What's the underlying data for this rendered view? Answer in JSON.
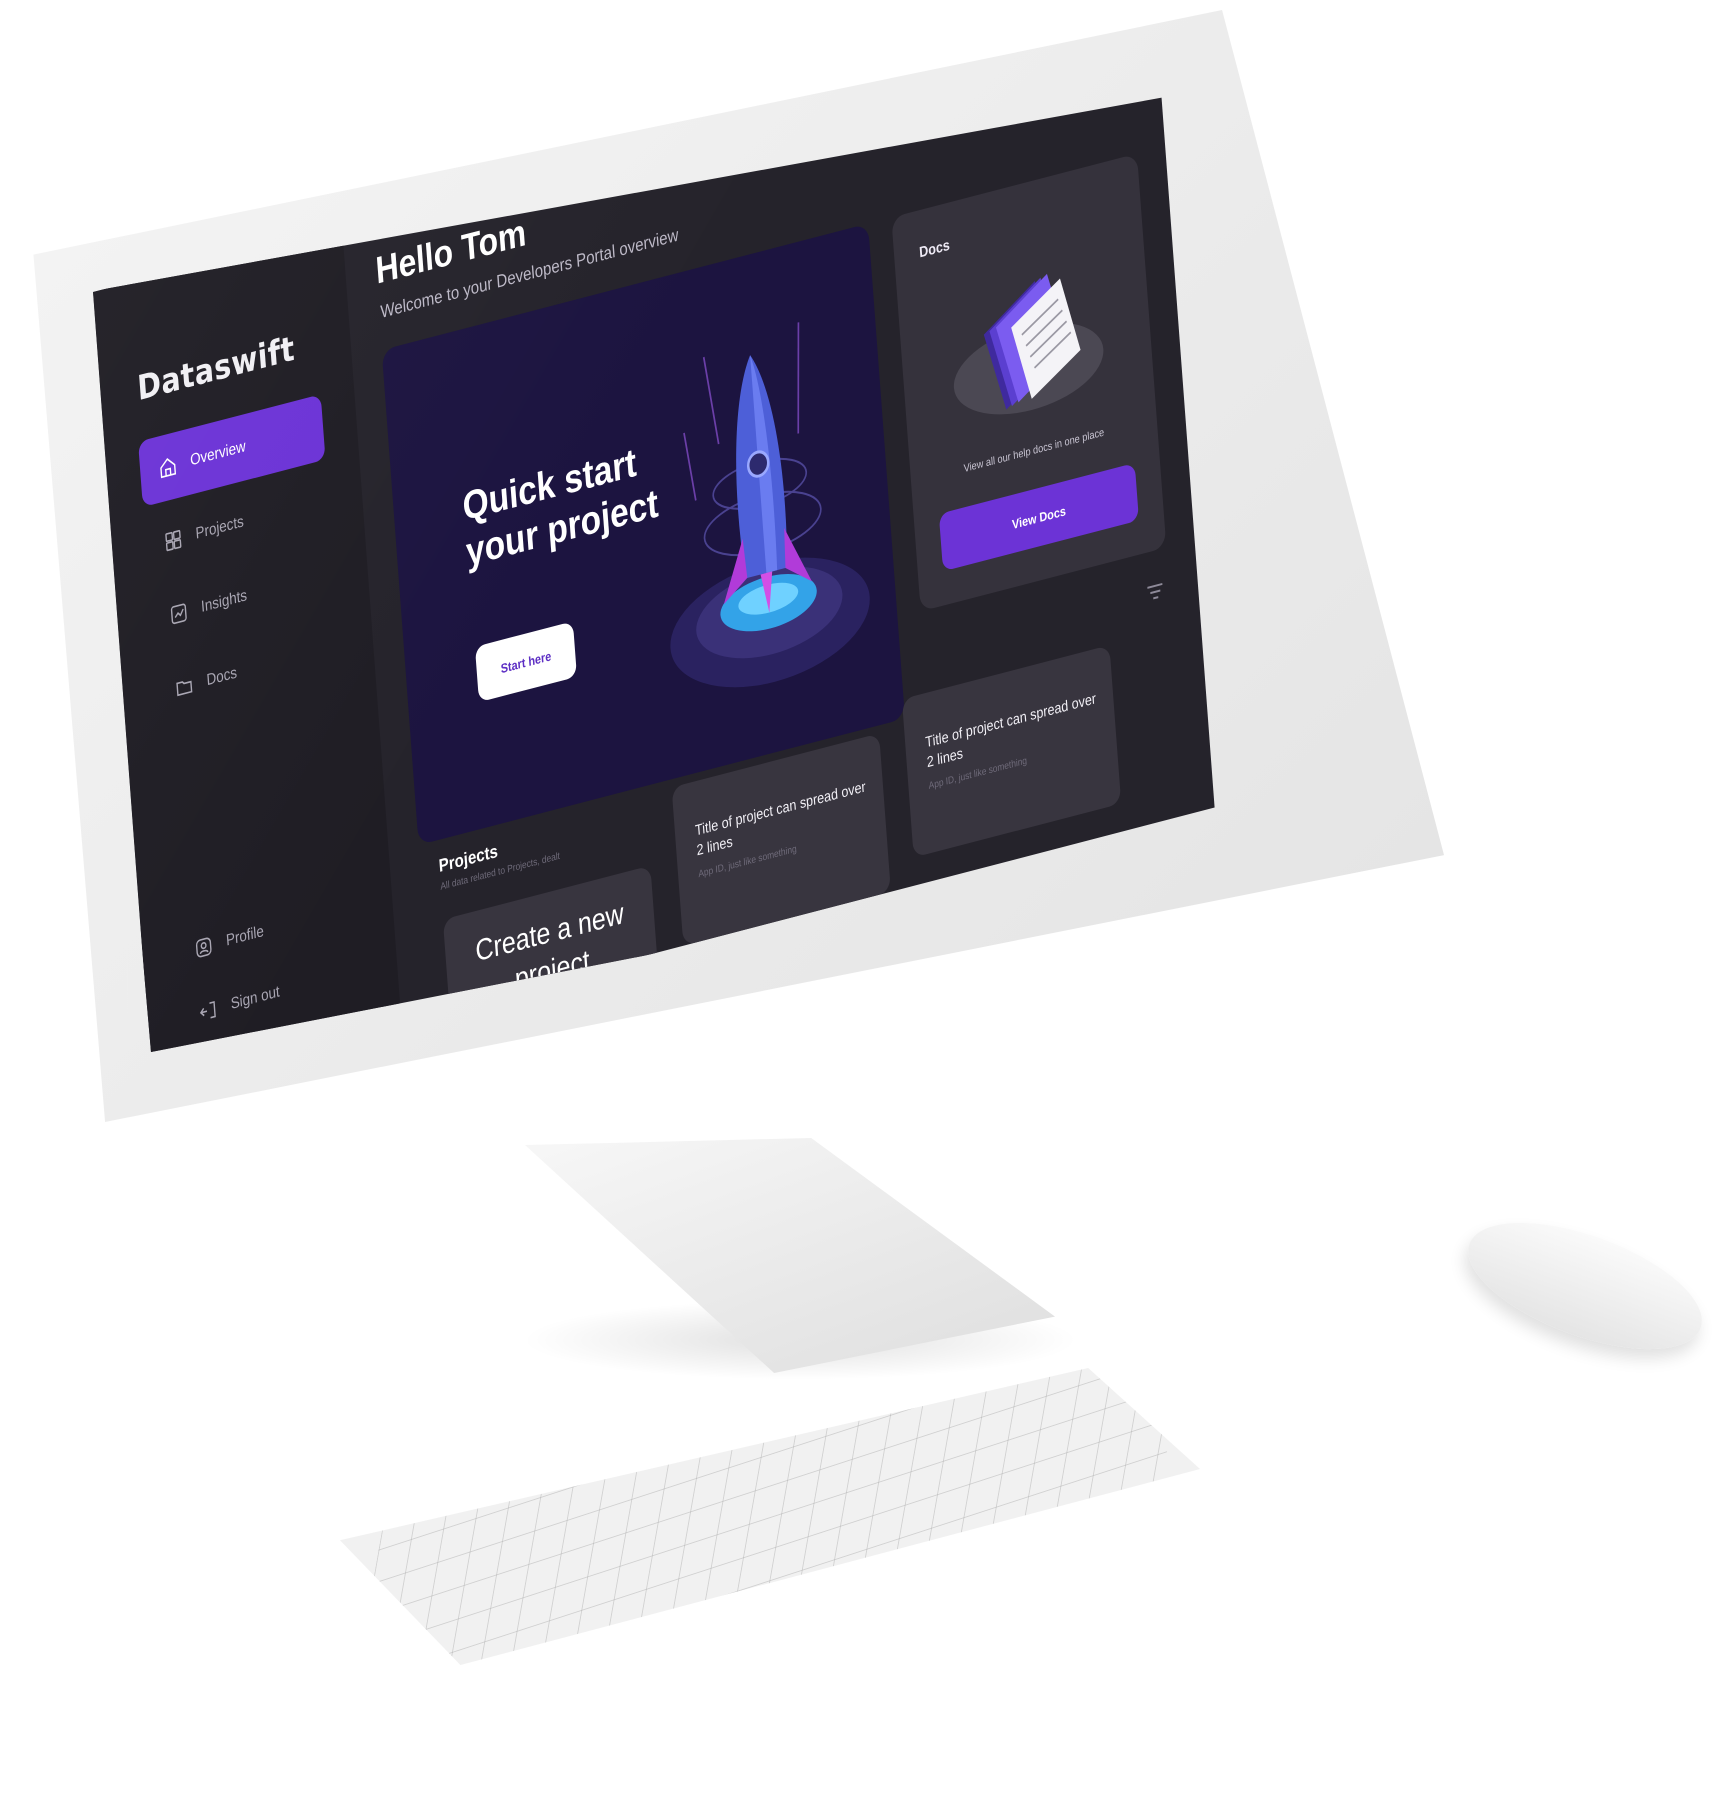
{
  "app": {
    "brand": "Dataswift"
  },
  "sidebar": {
    "items": [
      {
        "label": "Overview",
        "icon": "home-icon",
        "active": true
      },
      {
        "label": "Projects",
        "icon": "grid-icon",
        "active": false
      },
      {
        "label": "Insights",
        "icon": "chart-icon",
        "active": false
      },
      {
        "label": "Docs",
        "icon": "folder-icon",
        "active": false
      }
    ],
    "bottom": [
      {
        "label": "Profile",
        "icon": "user-icon"
      },
      {
        "label": "Sign out",
        "icon": "sign-out-icon"
      }
    ]
  },
  "header": {
    "title": "Hello Tom",
    "subtitle": "Welcome to your Developers Portal overview"
  },
  "hero": {
    "title": "Quick start your project",
    "button": "Start here"
  },
  "docs_card": {
    "label": "Docs",
    "description": "View all our help docs in one place",
    "button": "View Docs"
  },
  "projects": {
    "heading": "Projects",
    "subheading": "All data related to Projects, dealt",
    "create_label": "Create a new project",
    "cards": [
      {
        "title": "Title of project can spread over 2 lines",
        "desc": "App ID, just like something"
      },
      {
        "title": "Title of project can spread over 2 lines",
        "desc": "App ID, just like something"
      }
    ]
  },
  "colors": {
    "accent": "#6c33d6",
    "sidebar_bg": "#1f1d24",
    "main_bg": "#25232b",
    "hero_bg": "#1c1440",
    "card_bg": "#38353f"
  }
}
